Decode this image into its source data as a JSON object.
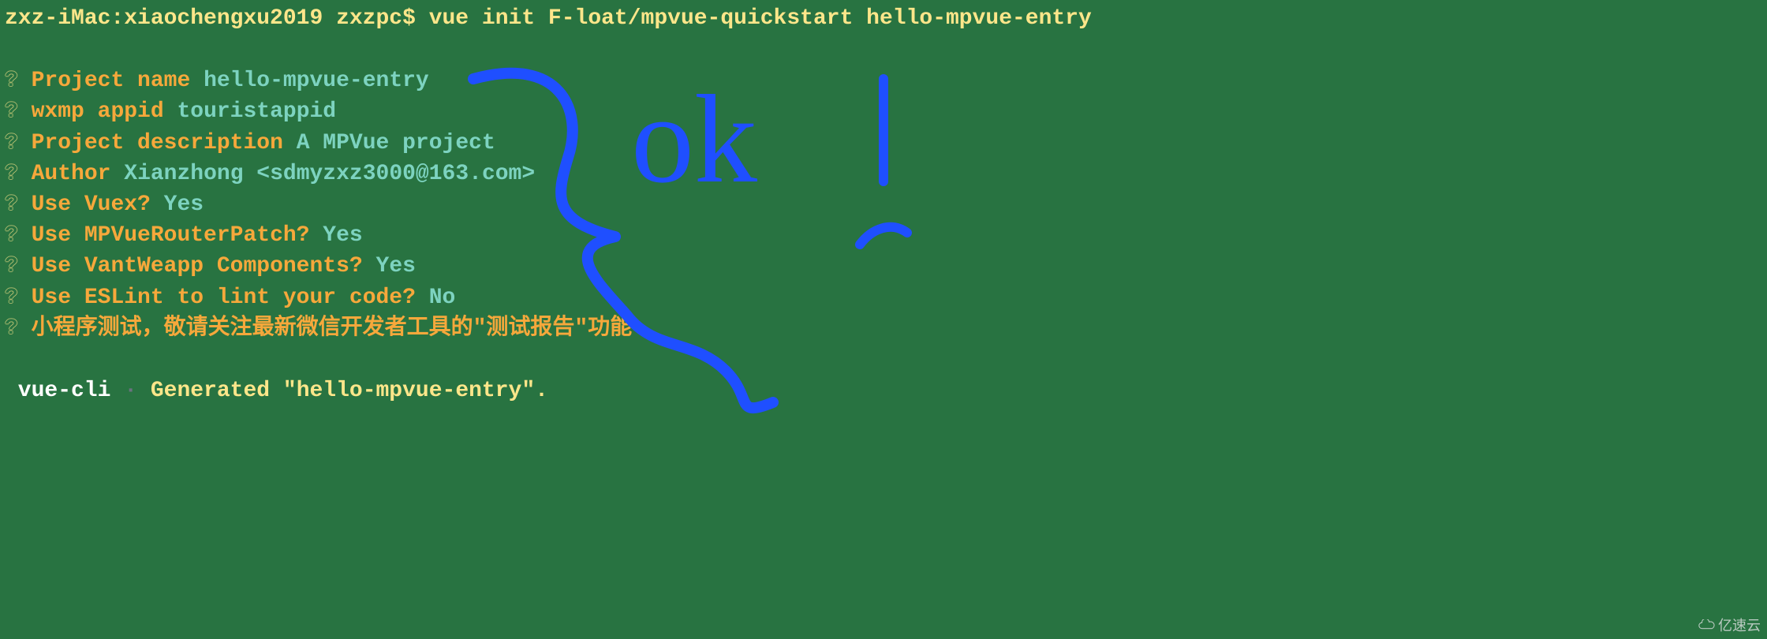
{
  "cmd": "zxz-iMac:xiaochengxu2019 zxzpc$ vue init F-loat/mpvue-quickstart hello-mpvue-entry",
  "prompts": [
    {
      "q": "?",
      "label": "Project name",
      "value": "hello-mpvue-entry"
    },
    {
      "q": "?",
      "label": "wxmp appid",
      "value": "touristappid"
    },
    {
      "q": "?",
      "label": "Project description",
      "value": "A MPVue project"
    },
    {
      "q": "?",
      "label": "Author",
      "value": "Xianzhong <sdmyzxz3000@163.com>"
    },
    {
      "q": "?",
      "label": "Use Vuex?",
      "value": "Yes"
    },
    {
      "q": "?",
      "label": "Use MPVueRouterPatch?",
      "value": "Yes"
    },
    {
      "q": "?",
      "label": "Use VantWeapp Components?",
      "value": "Yes"
    },
    {
      "q": "?",
      "label": "Use ESLint to lint your code?",
      "value": "No"
    }
  ],
  "notice": {
    "q": "?",
    "text": "小程序测试，敬请关注最新微信开发者工具的\"测试报告\"功能"
  },
  "footer": {
    "tool": "vue-cli",
    "dot": "·",
    "msg": "Generated \"hello-mpvue-entry\"."
  },
  "annotation": {
    "ok": "ok"
  },
  "watermark": "亿速云"
}
